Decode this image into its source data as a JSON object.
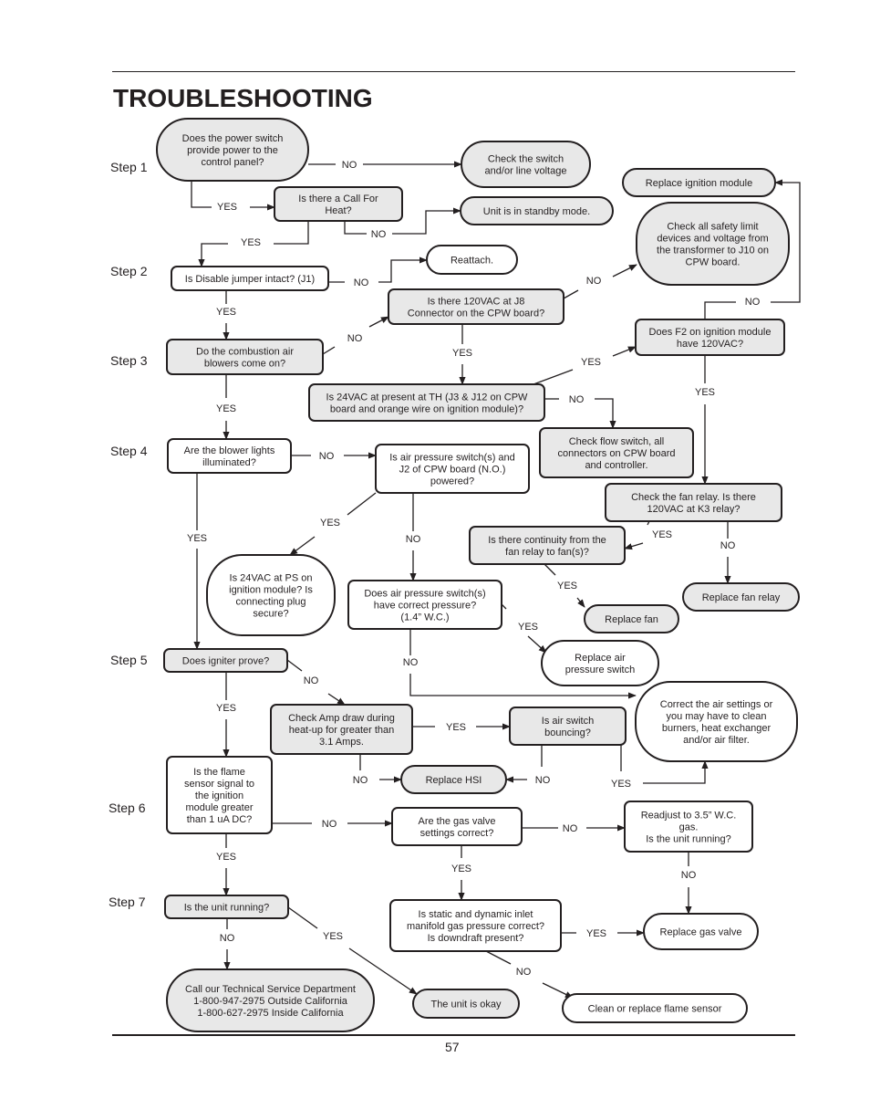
{
  "page": {
    "title": "TROUBLESHOOTING",
    "page_number": "57"
  },
  "colors": {
    "ink": "#231f20",
    "decision_fill": "#e8e8e8",
    "action_fill": "#ffffff"
  },
  "steps": [
    "Step 1",
    "Step 2",
    "Step 3",
    "Step 4",
    "Step 5",
    "Step 6",
    "Step 7"
  ],
  "nodes": [
    {
      "id": "power_switch",
      "text": [
        "Does the power switch",
        "provide power to the",
        "control panel?"
      ],
      "shape": "pill",
      "fill": "gray"
    },
    {
      "id": "check_switch",
      "text": [
        "Check the switch",
        "and/or line voltage"
      ],
      "shape": "pill",
      "fill": "gray"
    },
    {
      "id": "call_for_heat",
      "text": [
        "Is there a Call For",
        "Heat?"
      ],
      "shape": "box",
      "fill": "gray"
    },
    {
      "id": "standby",
      "text": [
        "Unit is in standby mode."
      ],
      "shape": "pill",
      "fill": "gray"
    },
    {
      "id": "replace_ignition",
      "text": [
        "Replace ignition module"
      ],
      "shape": "pill",
      "fill": "gray"
    },
    {
      "id": "check_safety",
      "text": [
        "Check all safety limit",
        "devices and voltage from",
        "the transformer to J10 on",
        "CPW board."
      ],
      "shape": "pill",
      "fill": "gray"
    },
    {
      "id": "jumper",
      "text": [
        "Is Disable jumper intact? (J1)"
      ],
      "shape": "box",
      "fill": "white"
    },
    {
      "id": "reattach",
      "text": [
        "Reattach."
      ],
      "shape": "pill",
      "fill": "white"
    },
    {
      "id": "j8",
      "text": [
        "Is there 120VAC at J8",
        "Connector on the CPW board?"
      ],
      "shape": "box",
      "fill": "gray"
    },
    {
      "id": "blowers",
      "text": [
        "Do the combustion air",
        "blowers come on?"
      ],
      "shape": "box",
      "fill": "gray"
    },
    {
      "id": "f2",
      "text": [
        "Does F2 on ignition module",
        "have 120VAC?"
      ],
      "shape": "box",
      "fill": "gray"
    },
    {
      "id": "th24",
      "text": [
        "Is 24VAC at present at TH (J3 & J12 on CPW",
        "board and orange wire on ignition module)?"
      ],
      "shape": "box",
      "fill": "gray"
    },
    {
      "id": "flow_switch",
      "text": [
        "Check flow switch, all",
        "connectors on CPW board",
        "and controller."
      ],
      "shape": "box",
      "fill": "gray"
    },
    {
      "id": "blower_lights",
      "text": [
        "Are the blower lights",
        "illuminated?"
      ],
      "shape": "box",
      "fill": "white"
    },
    {
      "id": "aps_powered",
      "text": [
        "Is air pressure switch(s) and",
        "J2 of CPW board (N.O.)",
        "powered?"
      ],
      "shape": "box",
      "fill": "white"
    },
    {
      "id": "fan_relay",
      "text": [
        "Check the fan relay. Is there",
        "120VAC at K3 relay?"
      ],
      "shape": "box",
      "fill": "gray"
    },
    {
      "id": "continuity",
      "text": [
        "Is there continuity from the",
        "fan relay to fan(s)?"
      ],
      "shape": "box",
      "fill": "gray"
    },
    {
      "id": "replace_fan_relay",
      "text": [
        "Replace fan relay"
      ],
      "shape": "pill",
      "fill": "gray"
    },
    {
      "id": "ps24",
      "text": [
        "Is 24VAC at PS on",
        "ignition module? Is",
        "connecting plug",
        "secure?"
      ],
      "shape": "pill",
      "fill": "white"
    },
    {
      "id": "aps_pressure",
      "text": [
        "Does air pressure switch(s)",
        "have correct pressure?",
        "(1.4” W.C.)"
      ],
      "shape": "box",
      "fill": "white"
    },
    {
      "id": "replace_fan",
      "text": [
        "Replace fan"
      ],
      "shape": "pill",
      "fill": "gray"
    },
    {
      "id": "replace_aps",
      "text": [
        "Replace air",
        "pressure switch"
      ],
      "shape": "pill",
      "fill": "white"
    },
    {
      "id": "igniter",
      "text": [
        "Does igniter prove?"
      ],
      "shape": "box",
      "fill": "gray"
    },
    {
      "id": "correct_air",
      "text": [
        "Correct the air settings or",
        "you may have to clean",
        "burners, heat exchanger",
        "and/or air filter."
      ],
      "shape": "pill",
      "fill": "white"
    },
    {
      "id": "amp_draw",
      "text": [
        "Check Amp draw during",
        "heat-up for greater than",
        "3.1 Amps."
      ],
      "shape": "box",
      "fill": "gray"
    },
    {
      "id": "air_bouncing",
      "text": [
        "Is air switch",
        "bouncing?"
      ],
      "shape": "box",
      "fill": "gray"
    },
    {
      "id": "replace_hsi",
      "text": [
        "Replace HSI"
      ],
      "shape": "pill",
      "fill": "gray"
    },
    {
      "id": "flame_signal",
      "text": [
        "Is the flame",
        "sensor signal to",
        "the ignition",
        "module greater",
        "than 1 uA DC?"
      ],
      "shape": "box",
      "fill": "white"
    },
    {
      "id": "gas_valve_settings",
      "text": [
        "Are the gas valve",
        "settings correct?"
      ],
      "shape": "box",
      "fill": "white"
    },
    {
      "id": "readjust",
      "text": [
        "Readjust to 3.5” W.C.",
        "gas.",
        "Is the unit running?"
      ],
      "shape": "box",
      "fill": "white"
    },
    {
      "id": "unit_running",
      "text": [
        "Is the unit running?"
      ],
      "shape": "box",
      "fill": "gray"
    },
    {
      "id": "static_dynamic",
      "text": [
        "Is static and dynamic inlet",
        "manifold gas pressure correct?",
        "Is downdraft present?"
      ],
      "shape": "box",
      "fill": "white"
    },
    {
      "id": "replace_gas_valve",
      "text": [
        "Replace gas valve"
      ],
      "shape": "pill",
      "fill": "white"
    },
    {
      "id": "call_service",
      "text": [
        "Call our Technical Service Department",
        "1-800-947-2975 Outside California",
        "1-800-627-2975 Inside California"
      ],
      "shape": "pill",
      "fill": "gray"
    },
    {
      "id": "unit_okay",
      "text": [
        "The unit is okay"
      ],
      "shape": "pill",
      "fill": "gray"
    },
    {
      "id": "clean_flame",
      "text": [
        "Clean or replace flame sensor"
      ],
      "shape": "pill",
      "fill": "white"
    }
  ],
  "edges": [
    {
      "from": "power_switch",
      "to": "check_switch",
      "label": "NO"
    },
    {
      "from": "power_switch",
      "to": "call_for_heat",
      "label": "YES"
    },
    {
      "from": "call_for_heat",
      "to": "standby",
      "label": "NO"
    },
    {
      "from": "call_for_heat",
      "to": "jumper",
      "label": "YES"
    },
    {
      "from": "jumper",
      "to": "reattach",
      "label": "NO"
    },
    {
      "from": "jumper",
      "to": "blowers",
      "label": "YES"
    },
    {
      "from": "blowers",
      "to": "j8",
      "label": "NO"
    },
    {
      "from": "j8",
      "to": "check_safety",
      "label": "NO"
    },
    {
      "from": "j8",
      "to": "th24",
      "label": "YES"
    },
    {
      "from": "th24",
      "to": "f2",
      "label": "YES"
    },
    {
      "from": "th24",
      "to": "flow_switch",
      "label": "NO"
    },
    {
      "from": "f2",
      "to": "replace_ignition",
      "label": "NO"
    },
    {
      "from": "f2",
      "to": "fan_relay",
      "label": "YES"
    },
    {
      "from": "blowers",
      "to": "blower_lights",
      "label": "YES"
    },
    {
      "from": "blower_lights",
      "to": "aps_powered",
      "label": "NO"
    },
    {
      "from": "blower_lights",
      "to": "igniter",
      "label": "YES"
    },
    {
      "from": "aps_powered",
      "to": "ps24",
      "label": "YES"
    },
    {
      "from": "aps_powered",
      "to": "aps_pressure",
      "label": "NO"
    },
    {
      "from": "fan_relay",
      "to": "continuity",
      "label": "YES"
    },
    {
      "from": "fan_relay",
      "to": "replace_fan_relay",
      "label": "NO"
    },
    {
      "from": "continuity",
      "to": "replace_fan",
      "label": "YES"
    },
    {
      "from": "aps_pressure",
      "to": "replace_aps",
      "label": "YES"
    },
    {
      "from": "aps_pressure",
      "to": "correct_air",
      "label": "NO"
    },
    {
      "from": "igniter",
      "to": "amp_draw",
      "label": "NO"
    },
    {
      "from": "igniter",
      "to": "flame_signal",
      "label": "YES"
    },
    {
      "from": "amp_draw",
      "to": "air_bouncing",
      "label": "YES"
    },
    {
      "from": "amp_draw",
      "to": "replace_hsi",
      "label": "NO"
    },
    {
      "from": "air_bouncing",
      "to": "replace_hsi",
      "label": "NO"
    },
    {
      "from": "air_bouncing",
      "to": "correct_air",
      "label": "YES"
    },
    {
      "from": "flame_signal",
      "to": "gas_valve_settings",
      "label": "NO"
    },
    {
      "from": "flame_signal",
      "to": "unit_running",
      "label": "YES"
    },
    {
      "from": "gas_valve_settings",
      "to": "readjust",
      "label": "NO"
    },
    {
      "from": "gas_valve_settings",
      "to": "static_dynamic",
      "label": "YES"
    },
    {
      "from": "readjust",
      "to": "replace_gas_valve",
      "label": "NO"
    },
    {
      "from": "static_dynamic",
      "to": "replace_gas_valve",
      "label": "YES"
    },
    {
      "from": "static_dynamic",
      "to": "clean_flame",
      "label": "NO"
    },
    {
      "from": "unit_running",
      "to": "call_service",
      "label": "NO"
    },
    {
      "from": "unit_running",
      "to": "unit_okay",
      "label": "YES"
    }
  ]
}
